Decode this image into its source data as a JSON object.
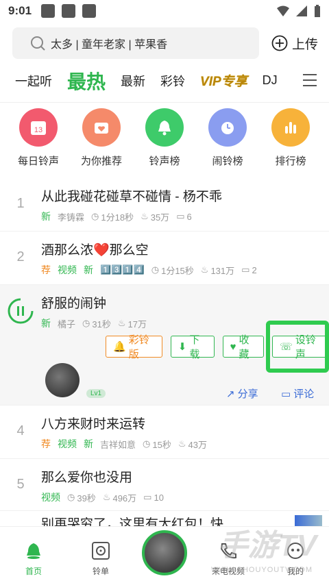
{
  "status": {
    "time": "9:01"
  },
  "search": {
    "placeholder": "太多 | 童年老家 | 苹果香"
  },
  "upload_label": "上传",
  "tabs": [
    {
      "label": "一起听"
    },
    {
      "label": "最热"
    },
    {
      "label": "最新"
    },
    {
      "label": "彩铃"
    },
    {
      "label": "VIP专享"
    },
    {
      "label": "DJ"
    }
  ],
  "categories": [
    {
      "label": "每日铃声",
      "color": "#f25a6e",
      "badge": "13"
    },
    {
      "label": "为你推荐",
      "color": "#f58a6a"
    },
    {
      "label": "铃声榜",
      "color": "#3ecb6a"
    },
    {
      "label": "闹铃榜",
      "color": "#8a9df0"
    },
    {
      "label": "排行榜",
      "color": "#f7b23a"
    }
  ],
  "songs": [
    {
      "num": "1",
      "title": "从此我碰花碰草不碰情 - 杨不乖",
      "tag1": "新",
      "author": "李铸霖",
      "duration": "1分18秒",
      "hot": "35万",
      "comments": "6"
    },
    {
      "num": "2",
      "title": "酒那么浓❤️那么空",
      "tag1": "荐",
      "tag2": "视频",
      "tag3": "新",
      "author": "1️⃣3️⃣1️⃣4️⃣",
      "duration": "1分15秒",
      "hot": "131万",
      "comments": "2"
    },
    {
      "num": "",
      "title": "舒服的闹钟",
      "tag1": "新",
      "author": "橘子",
      "duration": "31秒",
      "hot": "17万"
    },
    {
      "num": "4",
      "title": "八方来财时来运转",
      "tag1": "荐",
      "tag2": "视频",
      "tag3": "新",
      "author": "吉祥如意",
      "duration": "15秒",
      "hot": "43万"
    },
    {
      "num": "5",
      "title": "那么爱你也没用",
      "tag1": "视频",
      "duration": "39秒",
      "hot": "496万",
      "comments": "10"
    }
  ],
  "partial_title": "别再哭穷了，这里有大红包！快",
  "actions": {
    "cailing": "彩铃版",
    "download": "下载",
    "favorite": "收藏",
    "set_ringtone": "设铃声",
    "level": "Lv1",
    "share": "分享",
    "comment": "评论"
  },
  "bottom_nav": [
    {
      "label": "首页"
    },
    {
      "label": "铃单"
    },
    {
      "label": "来电视频"
    },
    {
      "label": "我的"
    }
  ],
  "watermark": {
    "text": "手游TV",
    "url": "WWW.SHOUYOUTV.COM"
  }
}
